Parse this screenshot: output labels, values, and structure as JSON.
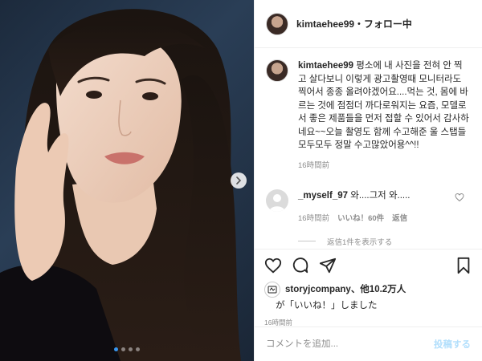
{
  "header": {
    "username": "kimtaehee99",
    "separator": "•",
    "follow_status": "フォロー中"
  },
  "caption": {
    "username": "kimtaehee99",
    "text": "평소에 내 사진을 전혀 안 찍고 살다보니 이렇게 광고촬영때 모니터라도 찍어서 종종 올려야겠어요....먹는 것, 몸에 바르는 것에 점점더 까다로워지는 요즘, 모델로서 좋은 제품들을 먼저 접할 수 있어서 감사하네요~~오늘 촬영도 함께 수고해준 울 스탭들 모두모두 정말 수고많았어용^^!!",
    "time": "16時間前"
  },
  "comment": {
    "username": "_myself_97",
    "text": "와....그저 와.....",
    "time": "16時間前",
    "likes": "いいね！60件",
    "reply": "返信"
  },
  "view_replies": "返信1件を表示する",
  "likes": {
    "liker": "storyjcompany",
    "rest": "、他10.2万人",
    "line2": "が「いいね！」しました",
    "time": "16時間前"
  },
  "add_comment": {
    "placeholder": "コメントを追加...",
    "post_label": "投稿する"
  },
  "carousel": {
    "slide_count": 4,
    "active_index": 0
  },
  "colors": {
    "accent": "#3897f0",
    "post_disabled": "#b2dffc",
    "muted": "#8e8e8e"
  },
  "icons": {
    "like": "heart-icon",
    "comment": "comment-icon",
    "share": "share-icon",
    "save": "bookmark-icon",
    "next": "chevron-right-icon"
  }
}
